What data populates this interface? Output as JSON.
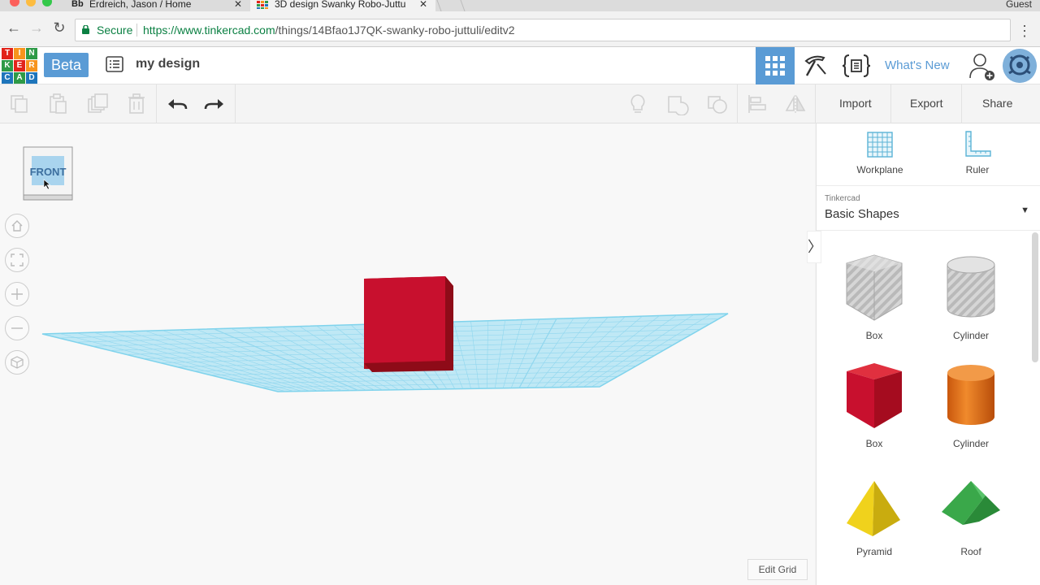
{
  "browser": {
    "tabs": [
      {
        "favicon": "Bb",
        "title": "Erdreich, Jason / Home"
      },
      {
        "favicon": "tinkercad-grid",
        "title": "3D design Swanky Robo-Juttu"
      }
    ],
    "profile": "Guest",
    "secure_label": "Secure",
    "url_host": "https://www.tinkercad.com",
    "url_path": "/things/14Bfao1J7QK-swanky-robo-juttuli/editv2"
  },
  "header": {
    "logo_letters": [
      "T",
      "I",
      "N",
      "K",
      "E",
      "R",
      "C",
      "A",
      "D"
    ],
    "logo_colors": [
      "#e2231a",
      "#f7941d",
      "#2e9a47",
      "#2e9a47",
      "#e2231a",
      "#f7941d",
      "#1e75bb",
      "#2e9a47",
      "#1e75bb"
    ],
    "beta_label": "Beta",
    "design_title": "my design",
    "whats_new": "What's New"
  },
  "toolbar": {
    "import_label": "Import",
    "export_label": "Export",
    "share_label": "Share"
  },
  "canvas": {
    "viewcube_label": "FRONT",
    "edit_grid_label": "Edit Grid",
    "object_color": "#c8102e",
    "workplane_color": "#7fd3ec"
  },
  "panel": {
    "workplane_label": "Workplane",
    "ruler_label": "Ruler",
    "library_source": "Tinkercad",
    "library_name": "Basic Shapes",
    "shapes": [
      {
        "name": "Box",
        "style": "hole"
      },
      {
        "name": "Cylinder",
        "style": "hole"
      },
      {
        "name": "Box",
        "color": "#d0112b"
      },
      {
        "name": "Cylinder",
        "color": "#e8741c"
      },
      {
        "name": "Pyramid",
        "color": "#f0d21c"
      },
      {
        "name": "Roof",
        "color": "#3aa84a"
      }
    ]
  },
  "accent_color": "#5a9bd5"
}
